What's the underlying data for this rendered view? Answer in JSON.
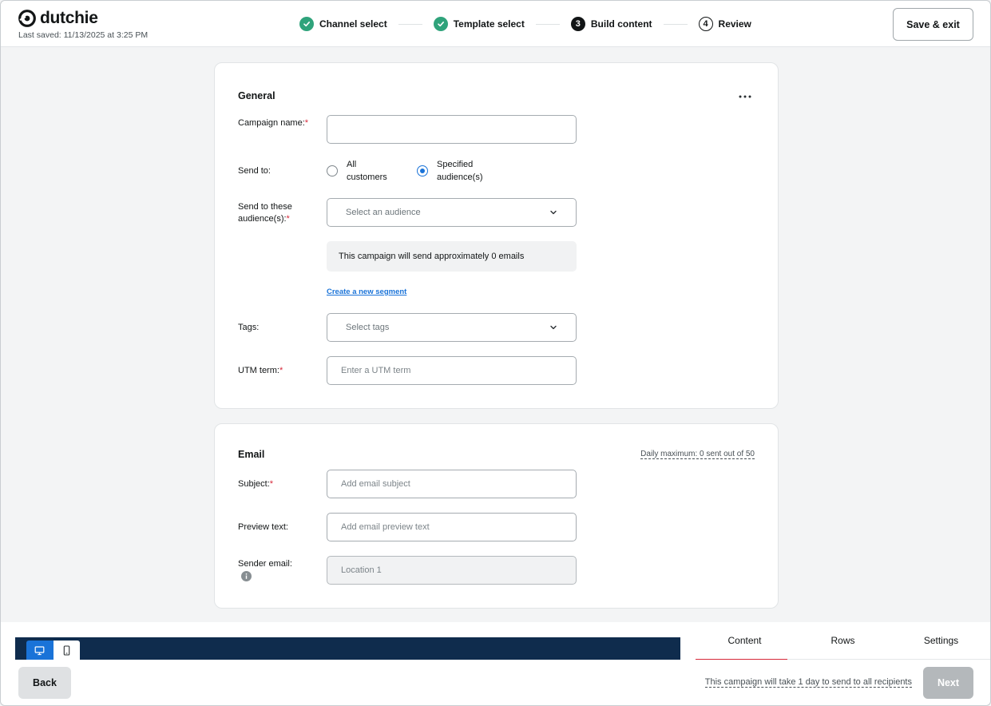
{
  "header": {
    "brand_name": "dutchie",
    "last_saved": "Last saved: 11/13/2025 at 3:25 PM",
    "steps": [
      {
        "number": "1",
        "label": "Channel select",
        "status": "done"
      },
      {
        "number": "2",
        "label": "Template select",
        "status": "done"
      },
      {
        "number": "3",
        "label": "Build content",
        "status": "current"
      },
      {
        "number": "4",
        "label": "Review",
        "status": "upcoming"
      }
    ],
    "save_exit_label": "Save & exit"
  },
  "general": {
    "title": "General",
    "more_icon": "more-horizontal-icon",
    "campaign_name": {
      "label": "Campaign name:",
      "required": "*",
      "value": ""
    },
    "send_to": {
      "label": "Send to:",
      "options": [
        {
          "label": "All customers",
          "checked": false
        },
        {
          "label": "Specified audience(s)",
          "checked": true
        }
      ]
    },
    "audiences": {
      "label": "Send to these audience(s):",
      "required": "*",
      "placeholder": "Select an audience"
    },
    "estimate_text": "This campaign will send approximately 0 emails",
    "create_segment_link": "Create a new segment",
    "tags": {
      "label": "Tags:",
      "placeholder": "Select tags"
    },
    "utm_term": {
      "label": "UTM term:",
      "required": "*",
      "placeholder": "Enter a UTM term"
    }
  },
  "email": {
    "title": "Email",
    "daily_maximum": "Daily maximum: 0 sent out of 50",
    "subject": {
      "label": "Subject:",
      "required": "*",
      "placeholder": "Add email subject"
    },
    "preview_text": {
      "label": "Preview text:",
      "placeholder": "Add email preview text"
    },
    "sender_email": {
      "label": "Sender email:",
      "placeholder": "Location 1",
      "info_icon": "info-icon"
    }
  },
  "editor": {
    "view_toggle": [
      {
        "icon": "desktop-icon",
        "active": true
      },
      {
        "icon": "mobile-icon",
        "active": false
      }
    ],
    "side_tabs": [
      {
        "label": "Content",
        "active": true
      },
      {
        "label": "Rows",
        "active": false
      },
      {
        "label": "Settings",
        "active": false
      }
    ]
  },
  "footer": {
    "back_label": "Back",
    "send_time_text": "This campaign will take 1 day to send to all recipients",
    "next_label": "Next"
  },
  "colors": {
    "accent_blue": "#1a73d8",
    "success_green": "#2fa37b",
    "required_red": "#d6293a",
    "canvas_navy": "#0f2c4d"
  }
}
